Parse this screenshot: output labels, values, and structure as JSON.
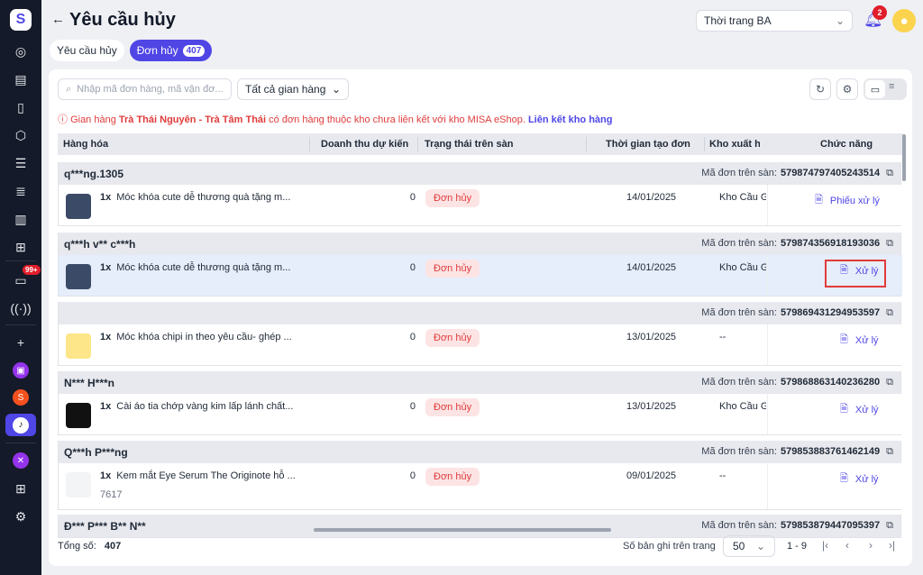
{
  "sidebar": {
    "items": [
      {
        "icon": "dashboard-icon"
      },
      {
        "icon": "order-check-icon"
      },
      {
        "icon": "document-icon"
      },
      {
        "icon": "box-icon"
      },
      {
        "icon": "list-icon"
      },
      {
        "icon": "checklist-icon"
      },
      {
        "icon": "chart-icon"
      },
      {
        "icon": "gift-icon"
      },
      {
        "icon": "chat-icon",
        "badge": "99+"
      },
      {
        "icon": "broadcast-icon"
      },
      {
        "icon": "plus-icon"
      },
      {
        "icon": "store-purple-icon"
      },
      {
        "icon": "shopee-icon"
      },
      {
        "icon": "tiktok-shop-icon",
        "active": true
      },
      {
        "icon": "integration-icon"
      },
      {
        "icon": "apps-add-icon"
      },
      {
        "icon": "settings-icon"
      }
    ]
  },
  "header": {
    "title": "Yêu cầu hủy",
    "shop_select": "Thời trang BA",
    "notifications": "2"
  },
  "tabs": [
    {
      "label": "Yêu cầu hủy"
    },
    {
      "label": "Đơn hủy",
      "count": "407",
      "active": true
    }
  ],
  "toolbar": {
    "search_placeholder": "Nhập mã đơn hàng, mã vận đơ...",
    "store_filter": "Tất cả gian hàng"
  },
  "warning": {
    "prefix": "Gian hàng ",
    "store": "Trà Thái Nguyên - Trà Tâm Thái",
    "message": " có đơn hàng thuộc kho chưa liên kết với kho MISA eShop. ",
    "link": "Liên kết kho hàng"
  },
  "columns": [
    "Hàng hóa",
    "Doanh thu dự kiến",
    "Trạng thái trên sàn",
    "Thời gian tạo đơn",
    "Kho xuất h",
    "Chức năng"
  ],
  "order_id_label": "Mã đơn trên sàn:",
  "orders": [
    {
      "buyer": "q***ng.1305",
      "order_id": "579874797405243514",
      "qty": "1x",
      "product": "Móc khóa cute dễ thương quà tặng m...",
      "sku": "",
      "revenue": "0",
      "status": "Đơn hủy",
      "date": "14/01/2025",
      "warehouse": "Kho Cầu G",
      "action": "Phiếu xử lý"
    },
    {
      "buyer": "q***h v** c***h",
      "order_id": "579874356918193036",
      "qty": "1x",
      "product": "Móc khóa cute dễ thương quà tặng m...",
      "sku": "",
      "revenue": "0",
      "status": "Đơn hủy",
      "date": "14/01/2025",
      "warehouse": "Kho Cầu G",
      "action": "Xử lý",
      "highlighted": true
    },
    {
      "buyer": "",
      "order_id": "579869431294953597",
      "qty": "1x",
      "product": "Móc khóa chipi in theo yêu cầu- ghép ...",
      "sku": "",
      "revenue": "0",
      "status": "Đơn hủy",
      "date": "13/01/2025",
      "warehouse": "--",
      "action": "Xử lý"
    },
    {
      "buyer": "N*** H***n",
      "order_id": "579868863140236280",
      "qty": "1x",
      "product": "Cài áo tia chớp vàng kim lấp lánh chất...",
      "sku": "",
      "revenue": "0",
      "status": "Đơn hủy",
      "date": "13/01/2025",
      "warehouse": "Kho Cầu G",
      "action": "Xử lý"
    },
    {
      "buyer": "Q***h P***ng",
      "order_id": "579853883761462149",
      "qty": "1x",
      "product": "Kem mắt Eye Serum The Originote hỗ ...",
      "sku": "7617",
      "revenue": "0",
      "status": "Đơn hủy",
      "date": "09/01/2025",
      "warehouse": "--",
      "action": "Xử lý"
    },
    {
      "buyer": "Đ*** P*** B** N**",
      "order_id": "579853879447095397"
    }
  ],
  "footer": {
    "total_label": "Tổng số:",
    "total": "407",
    "per_page_label": "Số bản ghi trên trang",
    "per_page": "50",
    "range": "1 - 9"
  },
  "colors": {
    "accent": "#4f46e5",
    "danger": "#e03b3b",
    "sidebar": "#141a29"
  }
}
